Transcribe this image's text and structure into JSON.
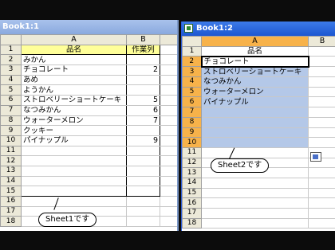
{
  "window1": {
    "title": "Book1:1",
    "col_headers": [
      "A",
      "B"
    ],
    "row_numbers": [
      "1",
      "2",
      "3",
      "4",
      "5",
      "6",
      "7",
      "8",
      "9",
      "10",
      "11",
      "12",
      "13",
      "14",
      "15",
      "16",
      "17",
      "18"
    ],
    "header_row": [
      "品名",
      "作業列"
    ],
    "rows": [
      [
        "みかん",
        ""
      ],
      [
        "チョコレート",
        "2"
      ],
      [
        "あめ",
        ""
      ],
      [
        "ようかん",
        ""
      ],
      [
        "ストロベリーショートケーキ",
        "5"
      ],
      [
        "なつみかん",
        "6"
      ],
      [
        "ウォーターメロン",
        "7"
      ],
      [
        "クッキー",
        ""
      ],
      [
        "パイナップル",
        "9"
      ]
    ],
    "callout": "Sheet1です"
  },
  "window2": {
    "title": "Book1:2",
    "col_headers": [
      "A",
      "B"
    ],
    "row_numbers": [
      "1",
      "2",
      "3",
      "4",
      "5",
      "6",
      "7",
      "8",
      "9",
      "10",
      "11",
      "12",
      "13",
      "14",
      "15",
      "16",
      "17",
      "18"
    ],
    "header_row": [
      "品名"
    ],
    "rows": [
      "チョコレート",
      "ストロベリーショートケーキ",
      "なつみかん",
      "ウォーターメロン",
      "パイナップル",
      "",
      "",
      "",
      ""
    ],
    "callout": "Sheet2です"
  },
  "colors": {
    "selection": "#b4c8e8",
    "header_fill": "#ffff99",
    "active_title": "#1c57d1"
  }
}
